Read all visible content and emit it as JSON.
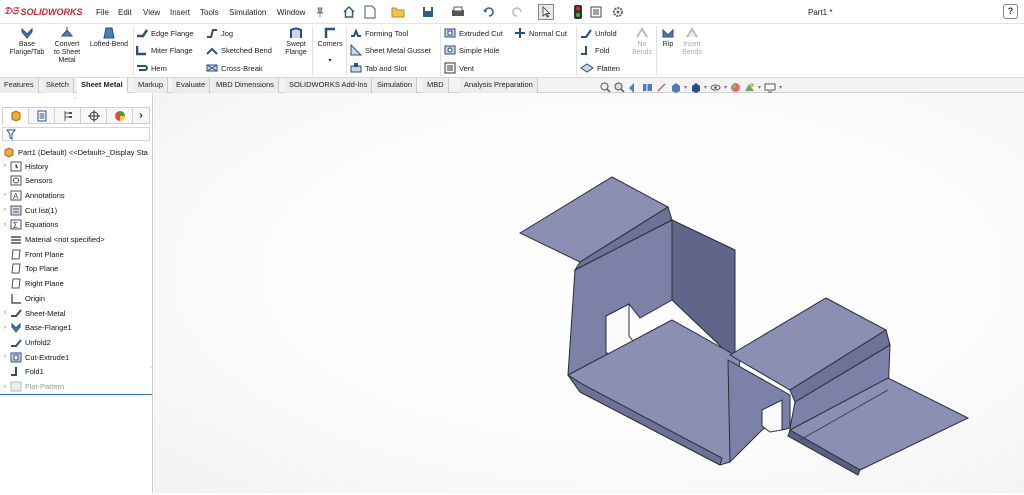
{
  "app": {
    "brand": "SOLIDWORKS",
    "doc_title": "Part1 *",
    "help_label": "?"
  },
  "menu": [
    "File",
    "Edit",
    "View",
    "Insert",
    "Tools",
    "Simulation",
    "Window"
  ],
  "ribbon": {
    "big": [
      {
        "label_lines": [
          "Base",
          "Flange/Tab"
        ],
        "icon": "base-flange-icon"
      },
      {
        "label_lines": [
          "Convert",
          "to Sheet",
          "Metal"
        ],
        "icon": "convert-sheet-metal-icon"
      },
      {
        "label_lines": [
          "Lofted-Bend"
        ],
        "icon": "lofted-bend-icon"
      },
      {
        "label_lines": [
          "Swept",
          "Flange"
        ],
        "icon": "swept-flange-icon"
      },
      {
        "label_lines": [
          "Corners"
        ],
        "icon": "corners-icon"
      },
      {
        "label_lines": [
          "Rip"
        ],
        "icon": "rip-icon"
      },
      {
        "label_lines": [
          "Insert",
          "Bends"
        ],
        "icon": "insert-bends-icon",
        "disabled": true
      },
      {
        "label_lines": [
          "No",
          "Bends"
        ],
        "icon": "no-bends-icon",
        "disabled": true
      }
    ],
    "small": {
      "edge_flange": "Edge Flange",
      "miter_flange": "Miter Flange",
      "hem": "Hem",
      "jog": "Jog",
      "sketched_bend": "Sketched Bend",
      "cross_break": "Cross-Break",
      "forming_tool": "Forming Tool",
      "sheet_metal_gusset": "Sheet Metal Gusset",
      "tab_and_slot": "Tab and Slot",
      "extruded_cut": "Extruded Cut",
      "simple_hole": "Simple Hole",
      "vent": "Vent",
      "normal_cut": "Normal Cut",
      "unfold": "Unfold",
      "fold": "Fold",
      "flatten": "Flatten"
    }
  },
  "tabs": [
    "Features",
    "Sketch",
    "Sheet Metal",
    "Markup",
    "Evaluate",
    "MBD Dimensions",
    "SOLIDWORKS Add-Ins",
    "Simulation",
    "MBD",
    "Analysis Preparation"
  ],
  "active_tab": "Sheet Metal",
  "tree": {
    "root": "Part1 (Default) <<Default>_Display Sta",
    "items": [
      {
        "label": "History",
        "icon": "history-icon",
        "expand": true
      },
      {
        "label": "Sensors",
        "icon": "sensors-icon",
        "expand": false
      },
      {
        "label": "Annotations",
        "icon": "annotations-icon",
        "expand": true
      },
      {
        "label": "Cut list(1)",
        "icon": "cut-list-icon",
        "expand": true
      },
      {
        "label": "Equations",
        "icon": "equations-icon",
        "expand": true
      },
      {
        "label": "Material <not specified>",
        "icon": "material-icon",
        "expand": false
      },
      {
        "label": "Front Plane",
        "icon": "plane-icon",
        "expand": false
      },
      {
        "label": "Top Plane",
        "icon": "plane-icon",
        "expand": false
      },
      {
        "label": "Right Plane",
        "icon": "plane-icon",
        "expand": false
      },
      {
        "label": "Origin",
        "icon": "origin-icon",
        "expand": false
      },
      {
        "label": "Sheet-Metal",
        "icon": "sheet-metal-icon",
        "expand": true
      },
      {
        "label": "Base-Flange1",
        "icon": "base-flange-icon",
        "expand": true
      },
      {
        "label": "Unfold2",
        "icon": "unfold-icon",
        "expand": false
      },
      {
        "label": "Cut-Extrude1",
        "icon": "cut-extrude-icon",
        "expand": true
      },
      {
        "label": "Fold1",
        "icon": "fold-icon",
        "expand": false
      },
      {
        "label": "Flat-Pattern",
        "icon": "flat-pattern-icon",
        "expand": true,
        "dim": true
      }
    ]
  },
  "colors": {
    "brand_red": "#d2232a",
    "part_face": "#8a8fb3",
    "part_side": "#6e7398",
    "part_dark": "#5a5f84"
  }
}
